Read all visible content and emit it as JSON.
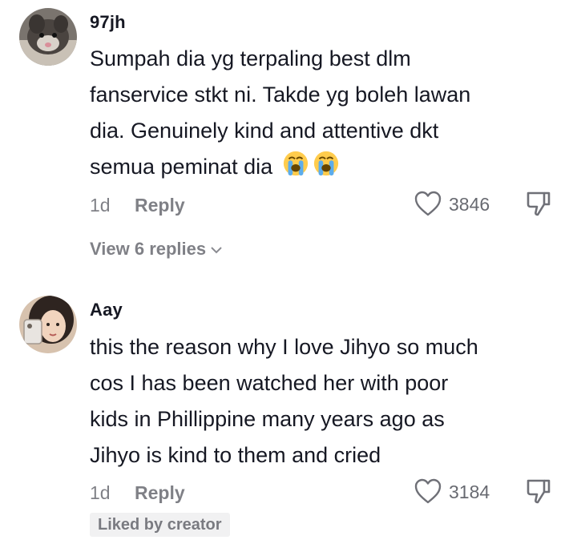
{
  "comments": [
    {
      "username": "97jh",
      "text_lines": [
        "Sumpah dia yg terpaling best dlm",
        "fanservice stkt ni. Takde yg boleh lawan",
        "dia. Genuinely kind and attentive dkt",
        "semua peminat dia"
      ],
      "emojis": [
        "loudly-crying-face-icon",
        "loudly-crying-face-icon"
      ],
      "time": "1d",
      "reply_label": "Reply",
      "like_count": "3846",
      "view_replies": "View 6 replies"
    },
    {
      "username": "Aay",
      "text_lines": [
        "this the reason why I love Jihyo so much",
        "cos I has been watched her with poor",
        "kids in Phillippine many years ago as",
        "Jihyo is kind to them and cried"
      ],
      "time": "1d",
      "reply_label": "Reply",
      "like_count": "3184",
      "badge": "Liked by creator"
    }
  ],
  "icons": {
    "like": "heart-outline-icon",
    "dislike": "thumbs-down-icon",
    "expand": "chevron-down-icon"
  },
  "colors": {
    "text": "#161823",
    "secondary": "#8a8b91",
    "badge_bg": "#f1f1f2",
    "emoji_face": "#ffcc4d",
    "emoji_tears": "#5dadec"
  }
}
